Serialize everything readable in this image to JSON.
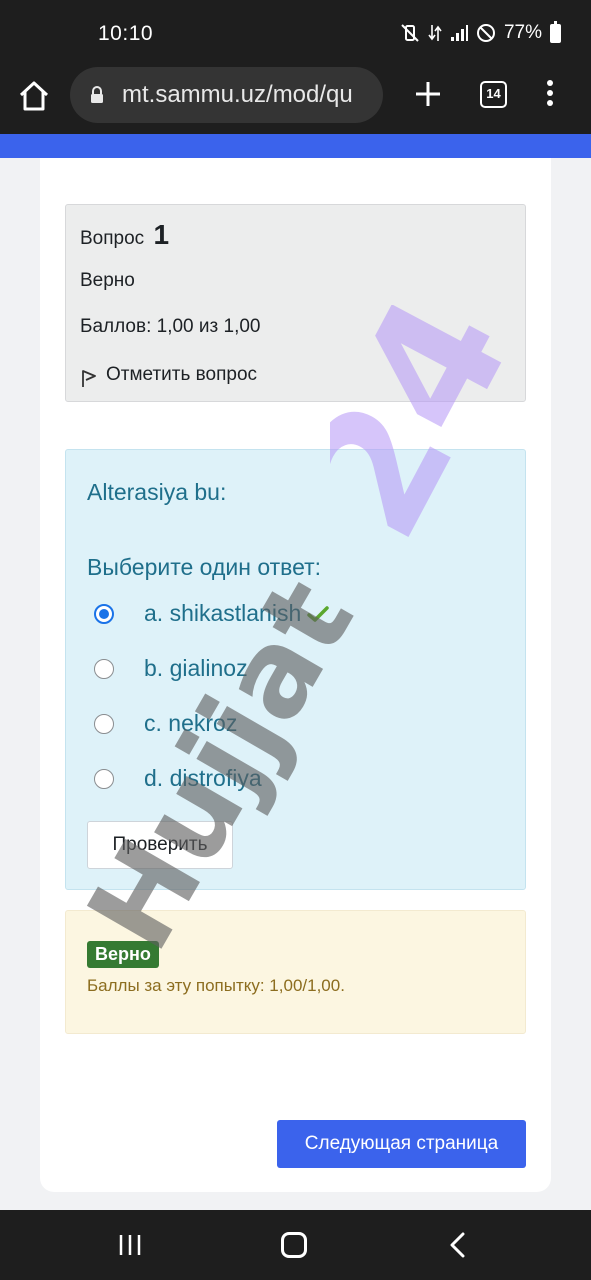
{
  "status_bar": {
    "time": "10:10",
    "battery": "77%",
    "icons": [
      "mute-vibrate-icon",
      "data-arrows-icon",
      "signal-icon",
      "do-not-disturb-icon",
      "battery-icon"
    ]
  },
  "browser": {
    "url": "mt.sammu.uz/mod/qu",
    "tab_count": "14",
    "icons": [
      "home-icon",
      "lock-icon",
      "plus-icon",
      "tabs-icon",
      "more-vert-icon"
    ]
  },
  "question_info": {
    "label": "Вопрос",
    "number": "1",
    "state": "Верно",
    "grade": "Баллов: 1,00 из 1,00",
    "flag_label": "Отметить вопрос"
  },
  "question": {
    "text": "Alterasiya bu:",
    "select_label": "Выберите один ответ:",
    "answers": [
      {
        "label": "a. shikastlanish",
        "checked": true,
        "correct": true
      },
      {
        "label": "b. gialinoz",
        "checked": false
      },
      {
        "label": "c. nekroz",
        "checked": false
      },
      {
        "label": "d. distrofiya",
        "checked": false
      }
    ],
    "check_button": "Проверить"
  },
  "feedback": {
    "badge": "Верно",
    "text": "Баллы за эту попытку: 1,00/1,00."
  },
  "next_button": "Следующая страница",
  "watermark": {
    "text": "Hujjat 24"
  },
  "colors": {
    "accent": "#3b63ec",
    "question_bg": "#def2f9",
    "question_text": "#1f6f8b",
    "feedback_bg": "#fcf6e1",
    "badge_bg": "#357a32",
    "watermark_gray": "#5f5f5f",
    "watermark_purple": "#b596f5"
  }
}
